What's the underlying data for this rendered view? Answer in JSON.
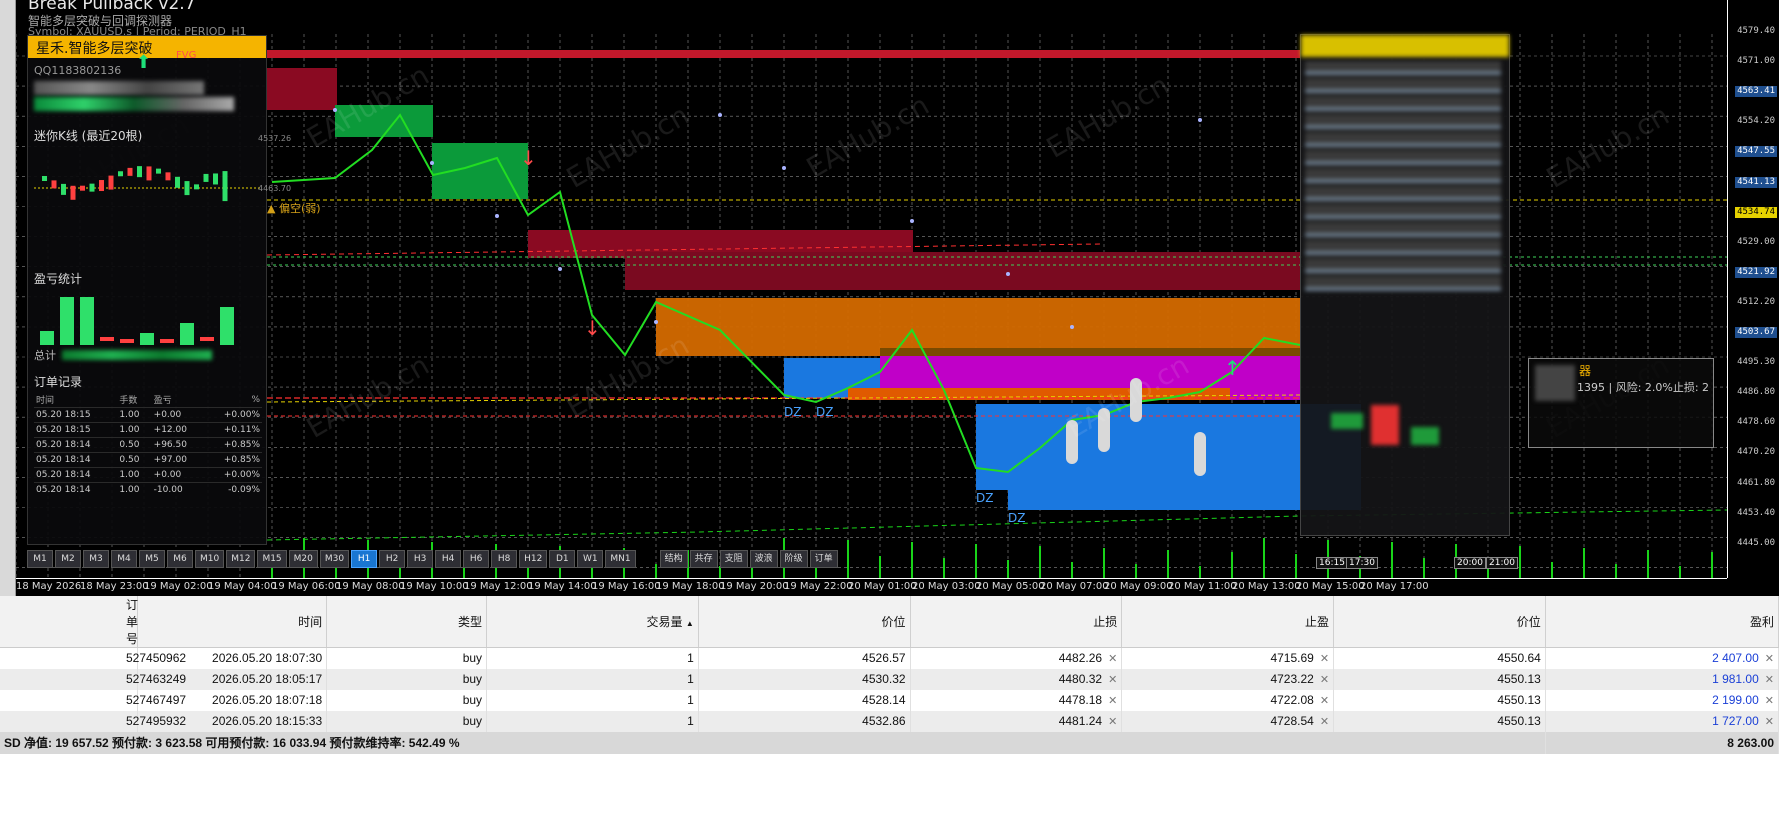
{
  "chart": {
    "title": "Break Pullback v2.7",
    "subtitle": "智能多层突破与回调探测器",
    "symbol_line": "Symbol: XAUUSD.s | Period: PERIOD_H1",
    "price_labels": [
      "4579.40",
      "4571.00",
      "4563.41",
      "4554.20",
      "4547.55",
      "4541.13",
      "4534.74",
      "4529.00",
      "4521.92",
      "4512.20",
      "4503.67",
      "4495.30",
      "4486.80",
      "4478.60",
      "4470.20",
      "4461.80",
      "4453.40",
      "4445.00"
    ],
    "time_labels": [
      "18 May 2026",
      "18 May 23:00",
      "19 May 02:00",
      "19 May 04:00",
      "19 May 06:00",
      "19 May 08:00",
      "19 May 10:00",
      "19 May 12:00",
      "19 May 14:00",
      "19 May 16:00",
      "19 May 18:00",
      "19 May 20:00",
      "19 May 22:00",
      "20 May 01:00",
      "20 May 03:00",
      "20 May 05:00",
      "20 May 07:00",
      "20 May 09:00",
      "20 May 11:00",
      "20 May 13:00",
      "20 May 15:00",
      "20 May 17:00"
    ],
    "small_time_labels": [
      "16:15",
      "17:30",
      "20:00",
      "21:00"
    ],
    "zone_labels": [
      "DZ",
      "DZ",
      "DZ",
      "DZ"
    ],
    "watermark": "EAHub.cn"
  },
  "left_panel": {
    "header": "星禾.智能多层突破",
    "fvg_label": "FVG",
    "qq": "QQ1183802136",
    "mini_kline_title": "迷你K线 (最近20根)",
    "mini_price_high": "4537.26",
    "mini_price_low": "4463.70",
    "strength_label": "偏空(弱)",
    "pnl_title": "盈亏统计",
    "total_label": "总计",
    "orders_title": "订单记录",
    "order_headers": [
      "时间",
      "手数",
      "盈亏",
      "%"
    ],
    "orders": [
      {
        "time": "05.20 18:15",
        "lots": "1.00",
        "pnl": "+0.00",
        "pct": "+0.00%"
      },
      {
        "time": "05.20 18:15",
        "lots": "1.00",
        "pnl": "+12.00",
        "pct": "+0.11%"
      },
      {
        "time": "05.20 18:14",
        "lots": "0.50",
        "pnl": "+96.50",
        "pct": "+0.85%"
      },
      {
        "time": "05.20 18:14",
        "lots": "0.50",
        "pnl": "+97.00",
        "pct": "+0.85%"
      },
      {
        "time": "05.20 18:14",
        "lots": "1.00",
        "pnl": "+0.00",
        "pct": "+0.00%"
      },
      {
        "time": "05.20 18:14",
        "lots": "1.00",
        "pnl": "-10.00",
        "pct": "-0.09%"
      }
    ]
  },
  "timeframes": [
    "M1",
    "M2",
    "M3",
    "M4",
    "M5",
    "M6",
    "M10",
    "M12",
    "M15",
    "M20",
    "M30",
    "H1",
    "H2",
    "H3",
    "H4",
    "H6",
    "H8",
    "H12",
    "D1",
    "W1",
    "MN1"
  ],
  "active_timeframe": "H1",
  "tools": [
    "结构",
    "共存",
    "支阻",
    "波浪",
    "阶级",
    "订单"
  ],
  "info_box": {
    "title": "器",
    "text": "1395 | 风险: 2.0%止损: 2"
  },
  "trade_table": {
    "headers": [
      "订单号",
      "时间",
      "类型",
      "交易量",
      "价位",
      "止损",
      "止盈",
      "价位",
      "盈利"
    ],
    "rows": [
      {
        "ticket": "527450962",
        "time": "2026.05.20 18:07:30",
        "type": "buy",
        "volume": "1",
        "open": "4526.57",
        "sl": "4482.26",
        "tp": "4715.69",
        "price": "4550.64",
        "profit": "2 407.00"
      },
      {
        "ticket": "527463249",
        "time": "2026.05.20 18:05:17",
        "type": "buy",
        "volume": "1",
        "open": "4530.32",
        "sl": "4480.32",
        "tp": "4723.22",
        "price": "4550.13",
        "profit": "1 981.00"
      },
      {
        "ticket": "527467497",
        "time": "2026.05.20 18:07:18",
        "type": "buy",
        "volume": "1",
        "open": "4528.14",
        "sl": "4478.18",
        "tp": "4722.08",
        "price": "4550.13",
        "profit": "2 199.00"
      },
      {
        "ticket": "527495932",
        "time": "2026.05.20 18:15:33",
        "type": "buy",
        "volume": "1",
        "open": "4532.86",
        "sl": "4481.24",
        "tp": "4728.54",
        "price": "4550.13",
        "profit": "1 727.00"
      }
    ],
    "summary": "SD  净值: 19 657.52  预付款: 3 623.58  可用预付款: 16 033.94  预付款维持率: 542.49 %",
    "summary_total": "8 263.00",
    "sort_arrow": "▲",
    "close_glyph": "✕"
  },
  "colors": {
    "bg": "#000000",
    "grid": "#8a8a8a",
    "price_line": "#22dd22",
    "supply": "#8a0a22",
    "demand_green": "#0b9a3a",
    "orange": "#d46a00",
    "blue_zone": "#1a78e0",
    "magenta": "#c000c8",
    "profit_blue": "#1a3fd6",
    "panel_header": "#f5b400"
  }
}
